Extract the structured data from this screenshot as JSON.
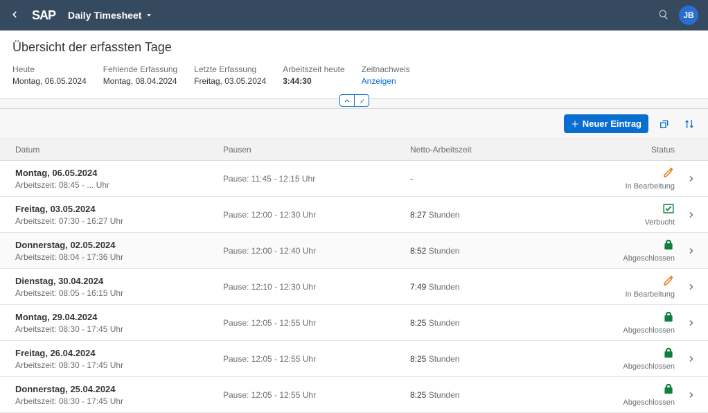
{
  "shell": {
    "title": "Daily Timesheet",
    "avatar": "JB"
  },
  "header": {
    "page_title": "Übersicht der erfassten Tage",
    "info": [
      {
        "label": "Heute",
        "value": "Montag, 06.05.2024",
        "kind": "plain"
      },
      {
        "label": "Fehlende Erfassung",
        "value": "Montag, 08.04.2024",
        "kind": "plain"
      },
      {
        "label": "Letzte Erfassung",
        "value": "Freitag, 03.05.2024",
        "kind": "plain"
      },
      {
        "label": "Arbeitszeit heute",
        "value": "3:44:30",
        "kind": "bold"
      },
      {
        "label": "Zeitnachweis",
        "value": "Anzeigen",
        "kind": "link"
      }
    ]
  },
  "toolbar": {
    "new_entry": "Neuer Eintrag"
  },
  "table": {
    "columns": {
      "date": "Datum",
      "pause": "Pausen",
      "net": "Netto-Arbeitszeit",
      "status": "Status"
    },
    "rows": [
      {
        "date": "Montag, 06.05.2024",
        "work": "Arbeitszeit: 08:45 - ... Uhr",
        "pause": "Pause: 11:45 - 12:15 Uhr",
        "net_val": "-",
        "net_unit": "",
        "status": "In Bearbeitung",
        "icon": "edit",
        "shaded": false
      },
      {
        "date": "Freitag, 03.05.2024",
        "work": "Arbeitszeit: 07:30 - 16:27 Uhr",
        "pause": "Pause: 12:00 - 12:30 Uhr",
        "net_val": "8:27",
        "net_unit": "Stunden",
        "status": "Verbucht",
        "icon": "check",
        "shaded": false
      },
      {
        "date": "Donnerstag, 02.05.2024",
        "work": "Arbeitszeit: 08:04 - 17:36 Uhr",
        "pause": "Pause: 12:00 - 12:40 Uhr",
        "net_val": "8:52",
        "net_unit": "Stunden",
        "status": "Abgeschlossen",
        "icon": "lock",
        "shaded": true
      },
      {
        "date": "Dienstag, 30.04.2024",
        "work": "Arbeitszeit: 08:05 - 16:15 Uhr",
        "pause": "Pause: 12:10 - 12:30 Uhr",
        "net_val": "7:49",
        "net_unit": "Stunden",
        "status": "In Bearbeitung",
        "icon": "edit",
        "shaded": false
      },
      {
        "date": "Montag, 29.04.2024",
        "work": "Arbeitszeit: 08:30 - 17:45 Uhr",
        "pause": "Pause: 12:05 - 12:55 Uhr",
        "net_val": "8:25",
        "net_unit": "Stunden",
        "status": "Abgeschlossen",
        "icon": "lock",
        "shaded": false
      },
      {
        "date": "Freitag, 26.04.2024",
        "work": "Arbeitszeit: 08:30 - 17:45 Uhr",
        "pause": "Pause: 12:05 - 12:55 Uhr",
        "net_val": "8:25",
        "net_unit": "Stunden",
        "status": "Abgeschlossen",
        "icon": "lock",
        "shaded": false
      },
      {
        "date": "Donnerstag, 25.04.2024",
        "work": "Arbeitszeit: 08:30 - 17:45 Uhr",
        "pause": "Pause: 12:05 - 12:55 Uhr",
        "net_val": "8:25",
        "net_unit": "Stunden",
        "status": "Abgeschlossen",
        "icon": "lock",
        "shaded": false
      }
    ]
  }
}
